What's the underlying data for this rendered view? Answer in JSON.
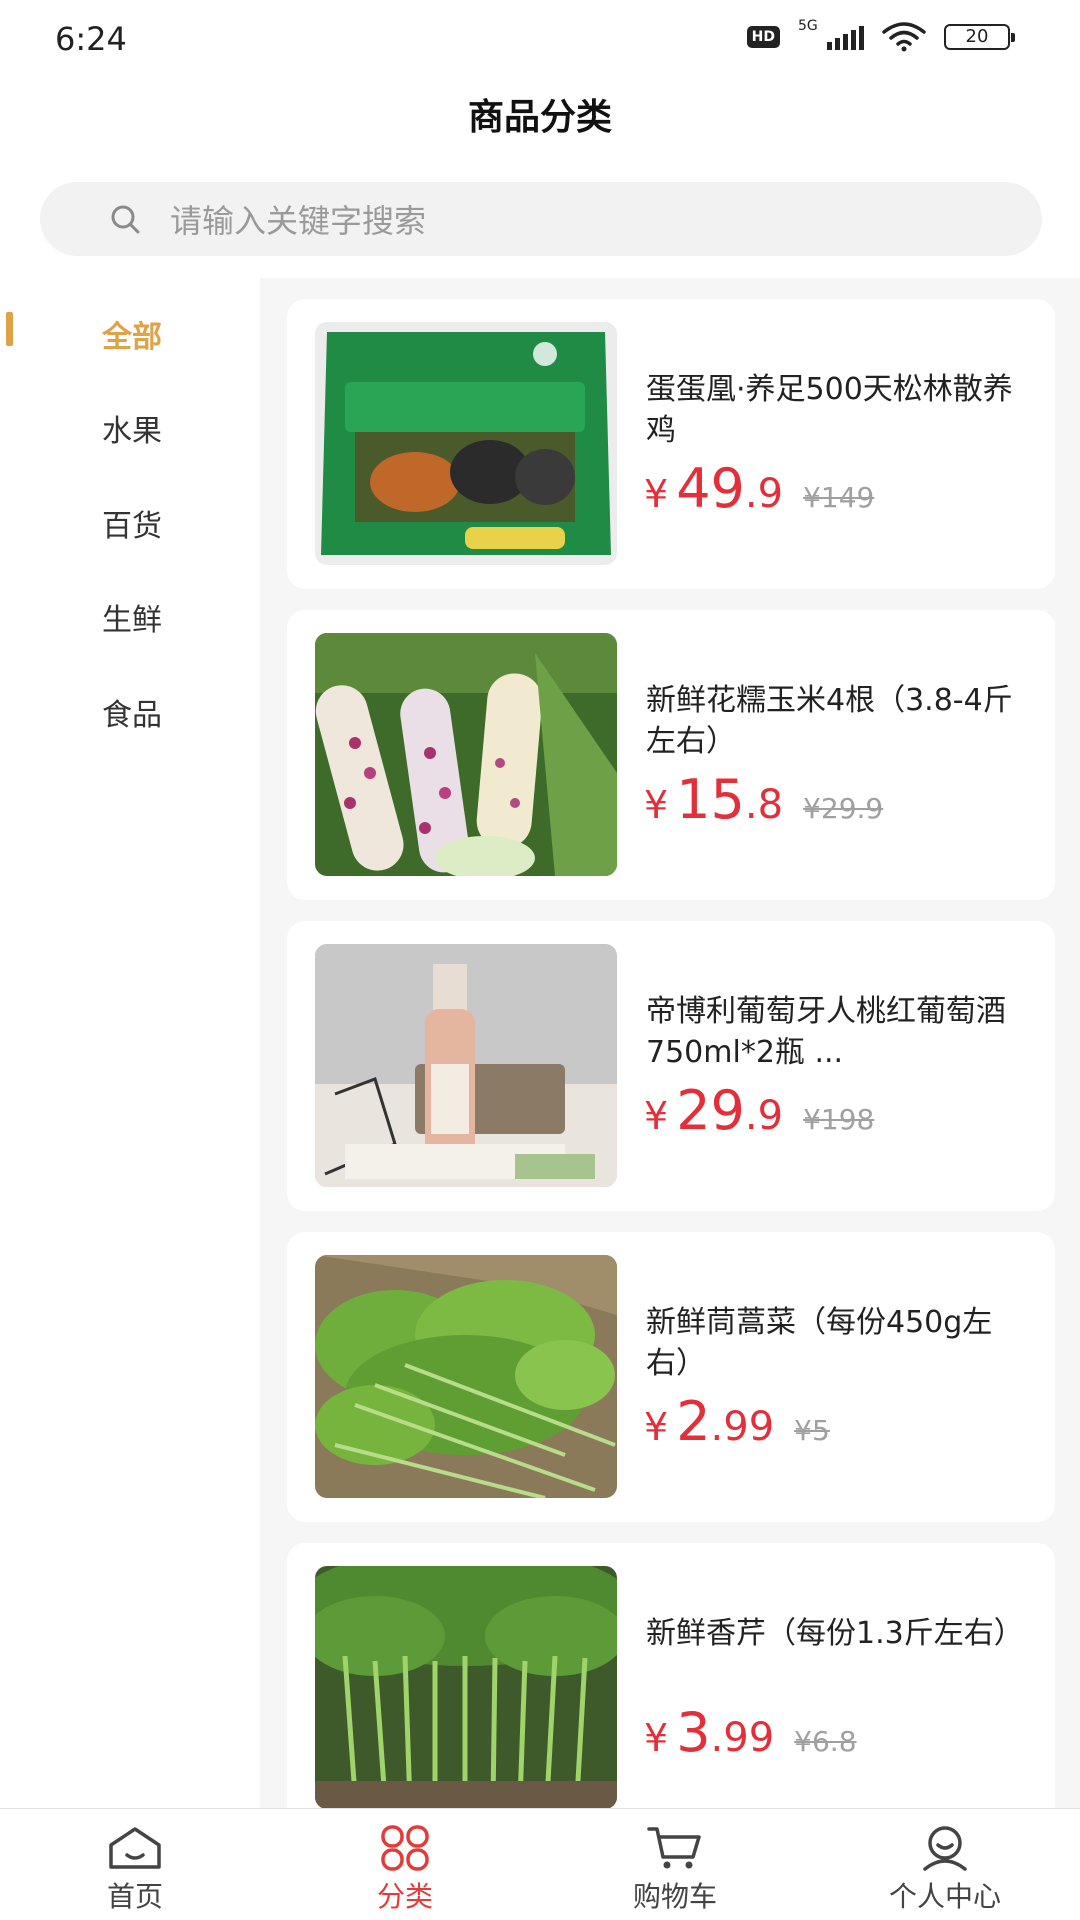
{
  "status_bar": {
    "time": "6:24",
    "hd": "HD",
    "network": "5G",
    "battery": "20"
  },
  "page_title": "商品分类",
  "search": {
    "placeholder": "请输入关键字搜索"
  },
  "categories": [
    {
      "label": "全部",
      "active": true
    },
    {
      "label": "水果",
      "active": false
    },
    {
      "label": "百货",
      "active": false
    },
    {
      "label": "生鲜",
      "active": false
    },
    {
      "label": "食品",
      "active": false
    }
  ],
  "products": [
    {
      "name": "蛋蛋凰·养足500天松林散养鸡",
      "price_symbol": "¥",
      "price_int": "49",
      "price_dec": ".9",
      "old_price": "¥149",
      "image": "chicken-package"
    },
    {
      "name": "新鲜花糯玉米4根（3.8-4斤左右）",
      "price_symbol": "¥",
      "price_int": "15",
      "price_dec": ".8",
      "old_price": "¥29.9",
      "image": "corn"
    },
    {
      "name": "帝博利葡萄牙人桃红葡萄酒750ml*2瓶 ...",
      "price_symbol": "¥",
      "price_int": "29",
      "price_dec": ".9",
      "old_price": "¥198",
      "image": "wine-bottle"
    },
    {
      "name": "新鲜茼蒿菜（每份450g左右）",
      "price_symbol": "¥",
      "price_int": "2",
      "price_dec": ".99",
      "old_price": "¥5",
      "image": "crown-daisy"
    },
    {
      "name": "新鲜香芹（每份1.3斤左右）",
      "price_symbol": "¥",
      "price_int": "3",
      "price_dec": ".99",
      "old_price": "¥6.8",
      "image": "celery"
    }
  ],
  "bottom_nav": [
    {
      "label": "首页",
      "icon": "home-icon",
      "active": false
    },
    {
      "label": "分类",
      "icon": "category-icon",
      "active": true
    },
    {
      "label": "购物车",
      "icon": "cart-icon",
      "active": false
    },
    {
      "label": "个人中心",
      "icon": "profile-icon",
      "active": false
    }
  ],
  "colors": {
    "accent": "#e0a247",
    "price": "#e32f3a",
    "nav_active": "#e33a3a"
  }
}
